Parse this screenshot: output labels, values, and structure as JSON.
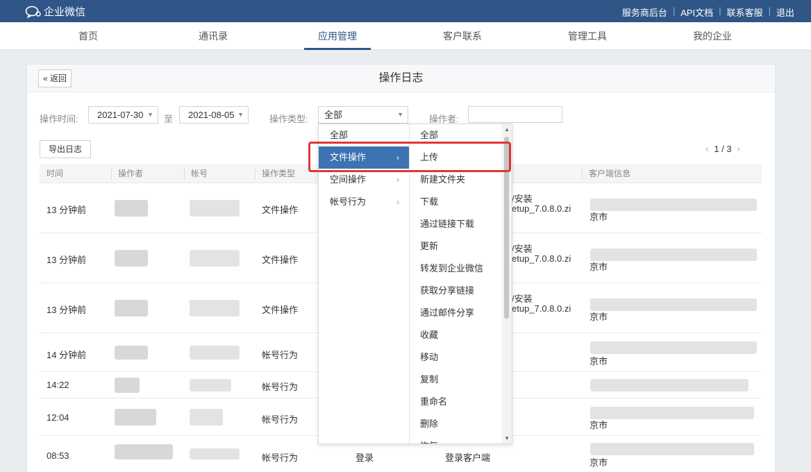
{
  "app": {
    "name": "企业微信"
  },
  "toplinks": [
    "服务商后台",
    "API文档",
    "联系客服",
    "退出"
  ],
  "nav": [
    "首页",
    "通讯录",
    "应用管理",
    "客户联系",
    "管理工具",
    "我的企业"
  ],
  "panel": {
    "back": "« 返回",
    "title": "操作日志"
  },
  "filters": {
    "time_label": "操作时间:",
    "start_date": "2021-07-30",
    "to": "至",
    "end_date": "2021-08-05",
    "type_label": "操作类型:",
    "type_value": "全部",
    "operator_label": "操作者:"
  },
  "export_label": "导出日志",
  "pager": {
    "prev": "‹",
    "text": "1 / 3",
    "next": "›"
  },
  "columns": [
    "时间",
    "操作者",
    "帐号",
    "操作类型",
    "客户端信息"
  ],
  "rows": [
    {
      "time": "13 分钟前",
      "type": "文件操作",
      "detail1": "/安装",
      "detail2": "etup_7.0.8.0.zi",
      "client": "京市"
    },
    {
      "time": "13 分钟前",
      "type": "文件操作",
      "detail1": "/安装",
      "detail2": "etup_7.0.8.0.zi",
      "client": "京市"
    },
    {
      "time": "13 分钟前",
      "type": "文件操作",
      "detail1": "/安装",
      "detail2": "etup_7.0.8.0.zi",
      "client": "京市"
    },
    {
      "time": "14 分钟前",
      "type": "帐号行为",
      "client": "京市"
    },
    {
      "time": "14:22",
      "type": "帐号行为"
    },
    {
      "time": "12:04",
      "type": "帐号行为",
      "client": "京市"
    },
    {
      "time": "08:53",
      "type": "帐号行为",
      "action": "登录",
      "target": "登录客户端",
      "client": "京市"
    }
  ],
  "dropdown": {
    "categories": [
      {
        "label": "全部",
        "arrow": ""
      },
      {
        "label": "文件操作",
        "arrow": "›"
      },
      {
        "label": "空间操作",
        "arrow": "›"
      },
      {
        "label": "帐号行为",
        "arrow": "›"
      }
    ],
    "options": [
      "全部",
      "上传",
      "新建文件夹",
      "下载",
      "通过链接下载",
      "更新",
      "转发到企业微信",
      "获取分享链接",
      "通过邮件分享",
      "收藏",
      "移动",
      "复制",
      "重命名",
      "删除",
      "恢复"
    ]
  }
}
